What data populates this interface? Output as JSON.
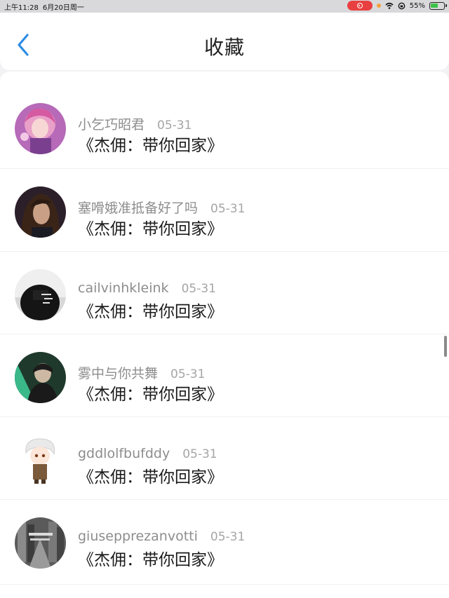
{
  "status_bar": {
    "time": "上午11:28",
    "date": "6月20日周一",
    "battery": "55%"
  },
  "header": {
    "title": "收藏"
  },
  "favorites": [
    {
      "username": "小乞巧昭君",
      "date": "05-31",
      "title": "《杰佣：带你回家》"
    },
    {
      "username": "塞嗗娥准抵备好了吗",
      "date": "05-31",
      "title": "《杰佣：带你回家》"
    },
    {
      "username": "cailvinhkleink",
      "date": "05-31",
      "title": "《杰佣：带你回家》"
    },
    {
      "username": "雾中与你共舞",
      "date": "05-31",
      "title": "《杰佣：带你回家》"
    },
    {
      "username": "gddlolfbufddy",
      "date": "05-31",
      "title": "《杰佣：带你回家》"
    },
    {
      "username": "giusepprezanvotti",
      "date": "05-31",
      "title": "《杰佣：带你回家》"
    }
  ],
  "colors": {
    "accent": "#2f8de4",
    "username": "#8d8d8d",
    "date": "#a5a5a5",
    "title": "#1a1a1a"
  },
  "icons": {
    "back": "chevron-left-icon",
    "wifi": "wifi-icon",
    "lock": "rotation-lock-icon",
    "battery": "battery-icon"
  }
}
